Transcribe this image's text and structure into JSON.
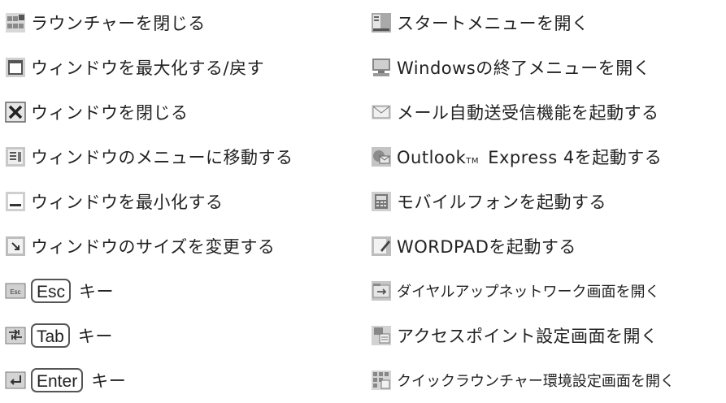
{
  "left": [
    {
      "icon": "launcher-close-icon",
      "label": "ラウンチャーを閉じる"
    },
    {
      "icon": "window-maximize-icon",
      "label": "ウィンドウを最大化する/戻す"
    },
    {
      "icon": "window-close-icon",
      "label": "ウィンドウを閉じる"
    },
    {
      "icon": "window-menu-icon",
      "label": "ウィンドウのメニューに移動する"
    },
    {
      "icon": "window-minimize-icon",
      "label": "ウィンドウを最小化する"
    },
    {
      "icon": "window-resize-icon",
      "label": "ウィンドウのサイズを変更する"
    },
    {
      "icon": "esc-icon",
      "key": "Esc",
      "label": "キー"
    },
    {
      "icon": "tab-icon",
      "key": "Tab",
      "label": "キー"
    },
    {
      "icon": "enter-icon",
      "key": "Enter",
      "label": "キー"
    }
  ],
  "right": [
    {
      "icon": "start-menu-icon",
      "label": "スタートメニューを開く"
    },
    {
      "icon": "windows-shutdown-icon",
      "label": "Windowsの終了メニューを開く"
    },
    {
      "icon": "mail-icon",
      "label": "メール自動送受信機能を起動する"
    },
    {
      "icon": "outlook-express-icon",
      "label_pre": "Outlook",
      "tm": "TM",
      "label": " Express 4を起動する"
    },
    {
      "icon": "mobile-phone-icon",
      "label": "モバイルフォンを起動する"
    },
    {
      "icon": "wordpad-icon",
      "label": "WORDPADを起動する"
    },
    {
      "icon": "dialup-network-icon",
      "label": "ダイヤルアップネットワーク画面を開く"
    },
    {
      "icon": "access-point-icon",
      "label": "アクセスポイント設定画面を開く"
    },
    {
      "icon": "quick-launcher-settings-icon",
      "label": "クイックラウンチャー環境設定画面を開く"
    }
  ]
}
